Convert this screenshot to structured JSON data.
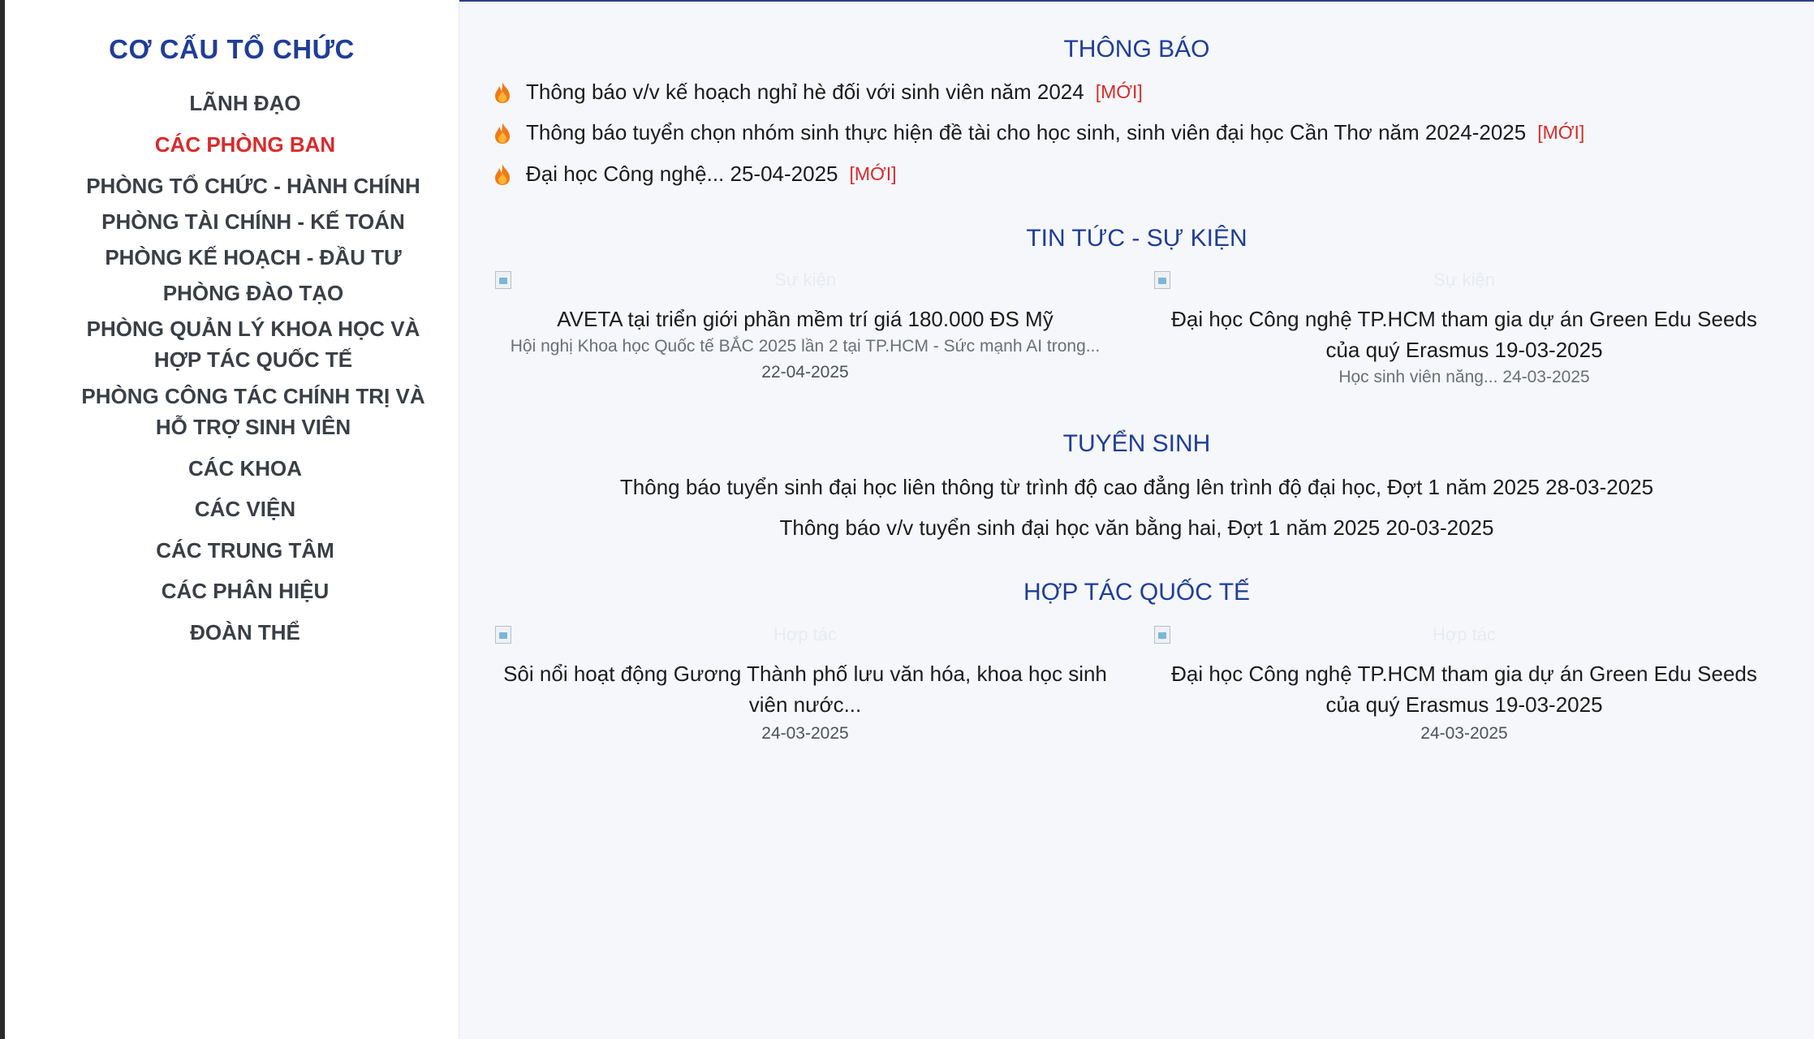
{
  "colors": {
    "accent": "#1f3d99",
    "active": "#d92b2b",
    "badge_new": "#d92b2b"
  },
  "sidebar": {
    "title": "CƠ CẤU TỔ CHỨC",
    "items": [
      {
        "label": "LÃNH ĐẠO"
      },
      {
        "label": "CÁC PHÒNG BAN"
      },
      {
        "label": "PHÒNG TỔ CHỨC - HÀNH CHÍNH"
      },
      {
        "label": "PHÒNG TÀI CHÍNH - KẾ TOÁN"
      },
      {
        "label": "PHÒNG KẾ HOẠCH - ĐẦU TƯ"
      },
      {
        "label": "PHÒNG ĐÀO TẠO"
      },
      {
        "label": "PHÒNG QUẢN LÝ KHOA HỌC VÀ HỢP TÁC QUỐC TẾ"
      },
      {
        "label": "PHÒNG CÔNG TÁC CHÍNH TRỊ VÀ HỖ TRỢ SINH VIÊN"
      },
      {
        "label": "CÁC KHOA"
      },
      {
        "label": "CÁC VIỆN"
      },
      {
        "label": "CÁC TRUNG TÂM"
      },
      {
        "label": "CÁC PHÂN HIỆU"
      },
      {
        "label": "ĐOÀN THỂ"
      }
    ]
  },
  "notices": {
    "title": "THÔNG BÁO",
    "items": [
      {
        "text": "Thông báo v/v kế hoạch nghỉ hè đối với sinh viên năm 2024",
        "badge": "[MỚI]",
        "icon": "fire-icon"
      },
      {
        "text": "Thông báo tuyển chọn nhóm sinh thực hiện đề tài cho học sinh, sinh viên đại học Cần Thơ năm 2024-2025",
        "badge": "[MỚI]",
        "icon": "fire-icon"
      },
      {
        "text": "Đại học Công nghệ... 25-04-2025",
        "badge": "[MỚI]",
        "icon": "fire-icon"
      }
    ]
  },
  "news": {
    "title": "TIN TỨC - SỰ KIỆN",
    "items": [
      {
        "image_alt": "Sự kiện",
        "title": "AVETA tại triển giới phần mềm trí giá 180.000 ĐS Mỹ",
        "desc": "Hội nghị Khoa học Quốc tế BẮC 2025 lần 2 tại TP.HCM - Sức mạnh AI trong...",
        "date": "22-04-2025"
      },
      {
        "image_alt": "Sự kiện",
        "title": "Đại học Công nghệ TP.HCM tham gia dự án Green Edu Seeds của quý Erasmus 19-03-2025",
        "desc": "Học sinh viên năng... 24-03-2025"
      }
    ]
  },
  "admissions": {
    "title": "TUYỂN SINH",
    "items": [
      {
        "text": "Thông báo tuyển sinh đại học liên thông từ trình độ cao đẳng lên trình độ đại học, Đợt 1 năm 2025 28-03-2025"
      },
      {
        "text": "Thông báo v/v tuyển sinh đại học văn bằng hai, Đợt 1 năm 2025 20-03-2025"
      }
    ]
  },
  "cooperation": {
    "title": "HỢP TÁC QUỐC TẾ",
    "items": [
      {
        "image_alt": "Hợp tác",
        "title": "Sôi nổi hoạt động Gương Thành phố lưu văn hóa, khoa học sinh viên nước...",
        "date": "24-03-2025"
      },
      {
        "image_alt": "Hợp tác",
        "title": "Đại học Công nghệ TP.HCM tham gia dự án Green Edu Seeds của quý Erasmus 19-03-2025",
        "date": "24-03-2025"
      }
    ]
  }
}
